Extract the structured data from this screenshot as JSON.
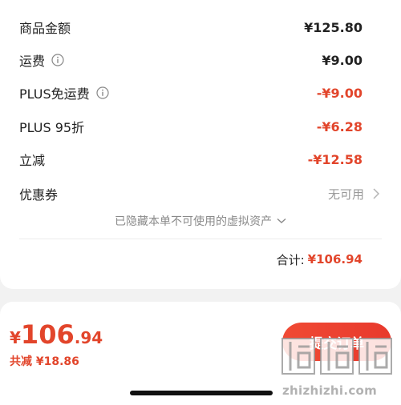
{
  "summary": {
    "rows": [
      {
        "label": "商品金额",
        "value": "¥125.80"
      },
      {
        "label": "运费",
        "value": "¥9.00"
      },
      {
        "label": "PLUS免运费",
        "value": "-¥9.00"
      },
      {
        "label": "PLUS 95折",
        "value": "-¥6.28"
      },
      {
        "label": "立减",
        "value": "-¥12.58"
      }
    ],
    "coupon": {
      "label": "优惠券",
      "status": "无可用"
    },
    "hidden_assets_text": "已隐藏本单不可使用的虚拟资产",
    "total": {
      "label": "合计:",
      "value": "¥106.94"
    }
  },
  "bottom": {
    "pay_currency": "¥",
    "pay_integer": "106",
    "pay_decimal": ".94",
    "saved_label": "共减",
    "saved_value": "¥18.86",
    "submit_label": "提交订单"
  },
  "watermark": {
    "text": "zhizhizhi.com"
  },
  "icons": {
    "info": "info-icon",
    "chevron_right": "chevron-right-icon",
    "chevron_down": "chevron-down-icon"
  },
  "colors": {
    "accent_red": "#e2452b",
    "muted_gray": "#999999",
    "background": "#f2f2f2"
  }
}
